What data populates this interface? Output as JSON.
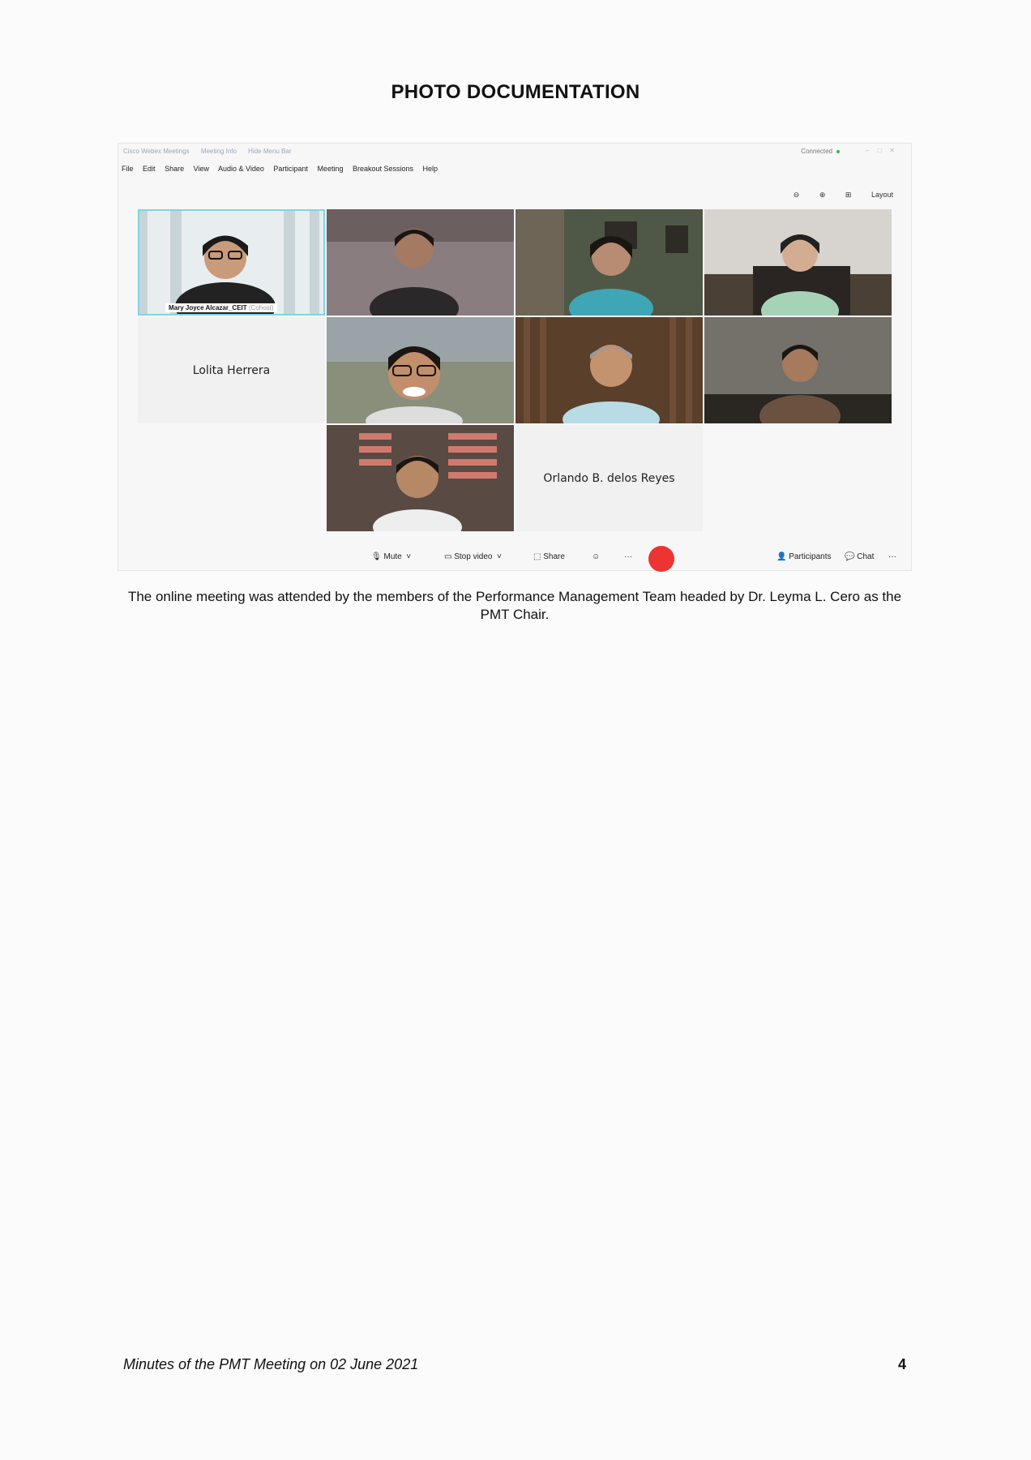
{
  "document": {
    "title": "PHOTO DOCUMENTATION",
    "caption": "The online meeting was attended by the members of the Performance Management Team headed by Dr. Leyma L. Cero as the PMT Chair.",
    "footer": "Minutes of the PMT Meeting on 02 June 2021",
    "page_number": "4"
  },
  "meeting_app": {
    "titlebar": {
      "app_name": "Cisco Webex Meetings",
      "meeting_info": "Meeting Info",
      "hide_menu": "Hide Menu Bar",
      "status": "Connected"
    },
    "menu": [
      "File",
      "Edit",
      "Share",
      "View",
      "Audio & Video",
      "Participant",
      "Meeting",
      "Breakout Sessions",
      "Help"
    ],
    "layout_label": "Layout",
    "participants": [
      {
        "name": "Mary Joyce Alcazar_CEIT",
        "role": "(Cohost)",
        "video": true
      },
      {
        "name": "Lolita Herrera",
        "video": false
      },
      {
        "name": "Orlando B. delos Reyes",
        "video": false
      }
    ],
    "controls": {
      "mute": "Mute",
      "stop_video": "Stop video",
      "share": "Share",
      "participants": "Participants",
      "chat": "Chat"
    }
  }
}
